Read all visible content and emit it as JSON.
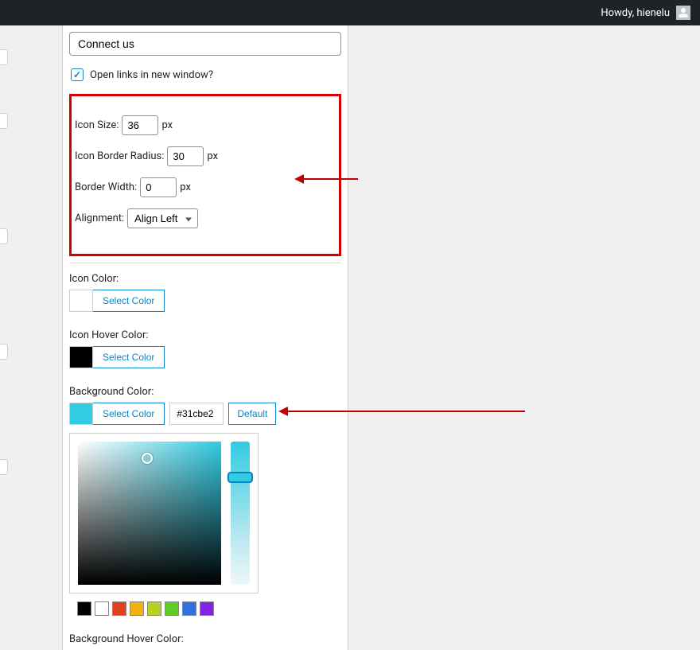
{
  "adminbar": {
    "greeting": "Howdy, hienelu"
  },
  "form": {
    "title_value": "Connect us",
    "open_links_label": "Open links in new window?",
    "open_links_checked": true,
    "icon_size_label": "Icon Size:",
    "icon_size_value": "36",
    "icon_size_unit": "px",
    "border_radius_label": "Icon Border Radius:",
    "border_radius_value": "30",
    "border_radius_unit": "px",
    "border_width_label": "Border Width:",
    "border_width_value": "0",
    "border_width_unit": "px",
    "alignment_label": "Alignment:",
    "alignment_value": "Align Left"
  },
  "colors": {
    "icon_color_label": "Icon Color:",
    "icon_hover_color_label": "Icon Hover Color:",
    "background_color_label": "Background Color:",
    "background_hover_color_label": "Background Hover Color:",
    "select_color_button": "Select Color",
    "default_button": "Default",
    "icon_color_swatch": "#ffffff",
    "icon_hover_color_swatch": "#000000",
    "background_color_swatch": "#31cbe2",
    "background_color_hex": "#31cbe2",
    "palette": [
      "#000000",
      "#ffffff",
      "#e2401c",
      "#eeb313",
      "#b5d126",
      "#5fcc29",
      "#2f71e0",
      "#8224e3"
    ]
  }
}
